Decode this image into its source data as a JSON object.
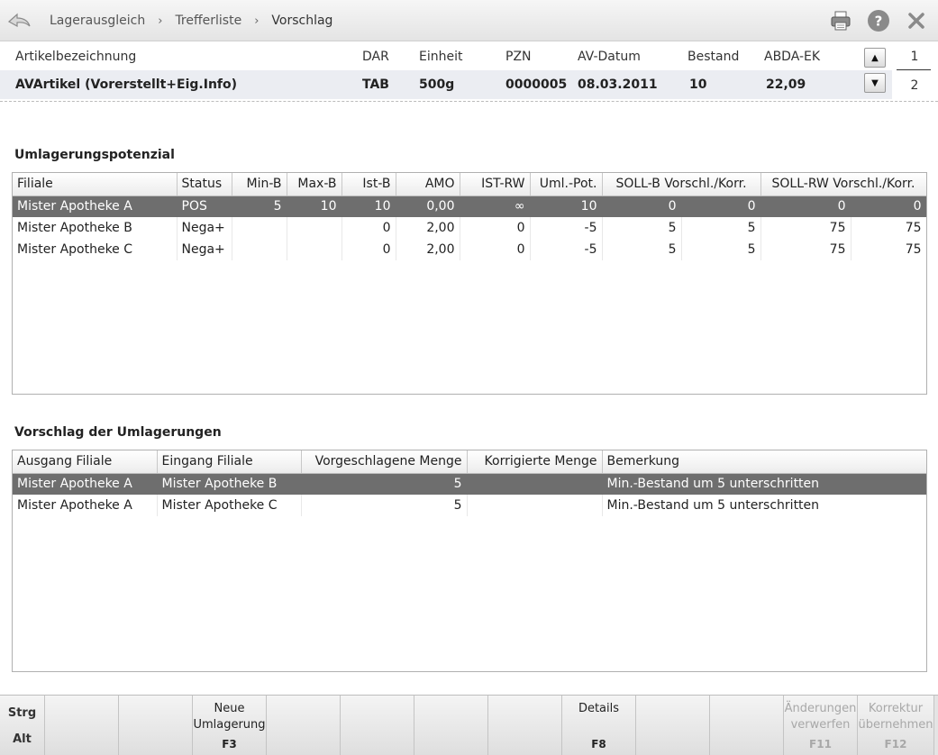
{
  "breadcrumb": [
    "Lagerausgleich",
    "Trefferliste",
    "Vorschlag"
  ],
  "header_icons": [
    "printer-icon",
    "help-icon",
    "close-icon"
  ],
  "article": {
    "headers": {
      "name": "Artikelbezeichnung",
      "dar": "DAR",
      "einheit": "Einheit",
      "pzn": "PZN",
      "av_datum": "AV-Datum",
      "bestand": "Bestand",
      "abda_ek": "ABDA-EK"
    },
    "row": {
      "name": "AVArtikel (Vorerstellt+Eig.Info)",
      "dar": "TAB",
      "einheit": "500g",
      "pzn": "0000005",
      "av_datum": "08.03.2011",
      "bestand": "10",
      "abda_ek": "22,09"
    },
    "page_current": "1",
    "page_total": "2"
  },
  "potenzial": {
    "title": "Umlagerungspotenzial",
    "columns": [
      "Filiale",
      "Status",
      "Min-B",
      "Max-B",
      "Ist-B",
      "AMO",
      "IST-RW",
      "Uml.-Pot.",
      "SOLL-B Vorschl./Korr.",
      "SOLL-RW Vorschl./Korr."
    ],
    "rows": [
      {
        "filiale": "Mister Apotheke A",
        "status": "POS",
        "minb": "5",
        "maxb": "10",
        "istb": "10",
        "amo": "0,00",
        "istrw": "∞",
        "umlpot": "10",
        "sollb_v": "0",
        "sollb_k": "0",
        "sollrw_v": "0",
        "sollrw_k": "0",
        "selected": true
      },
      {
        "filiale": "Mister Apotheke B",
        "status": "Nega+",
        "minb": "",
        "maxb": "",
        "istb": "0",
        "amo": "2,00",
        "istrw": "0",
        "umlpot": "-5",
        "sollb_v": "5",
        "sollb_k": "5",
        "sollrw_v": "75",
        "sollrw_k": "75",
        "selected": false
      },
      {
        "filiale": "Mister Apotheke C",
        "status": "Nega+",
        "minb": "",
        "maxb": "",
        "istb": "0",
        "amo": "2,00",
        "istrw": "0",
        "umlpot": "-5",
        "sollb_v": "5",
        "sollb_k": "5",
        "sollrw_v": "75",
        "sollrw_k": "75",
        "selected": false
      }
    ]
  },
  "vorschlag": {
    "title": "Vorschlag der Umlagerungen",
    "columns": [
      "Ausgang Filiale",
      "Eingang Filiale",
      "Vorgeschlagene Menge",
      "Korrigierte Menge",
      "Bemerkung"
    ],
    "rows": [
      {
        "ausgang": "Mister Apotheke A",
        "eingang": "Mister Apotheke B",
        "vorgeschlagen": "5",
        "korrigiert": "",
        "bemerkung": "Min.-Bestand um 5 unterschritten",
        "selected": true
      },
      {
        "ausgang": "Mister Apotheke A",
        "eingang": "Mister Apotheke C",
        "vorgeschlagen": "5",
        "korrigiert": "",
        "bemerkung": "Min.-Bestand um 5 unterschritten",
        "selected": false
      }
    ]
  },
  "footer": {
    "mod_top": "Strg",
    "mod_bottom": "Alt",
    "keys": [
      {
        "label": "",
        "key": "",
        "disabled": false
      },
      {
        "label": "",
        "key": "",
        "disabled": false
      },
      {
        "label": "Neue\nUmlagerung",
        "key": "F3",
        "disabled": false
      },
      {
        "label": "",
        "key": "",
        "disabled": false
      },
      {
        "label": "",
        "key": "",
        "disabled": false
      },
      {
        "label": "",
        "key": "",
        "disabled": false
      },
      {
        "label": "",
        "key": "",
        "disabled": false
      },
      {
        "label": "Details",
        "key": "F8",
        "disabled": false
      },
      {
        "label": "",
        "key": "",
        "disabled": false
      },
      {
        "label": "",
        "key": "",
        "disabled": false
      },
      {
        "label": "Änderungen\nverwerfen",
        "key": "F11",
        "disabled": true
      },
      {
        "label": "Korrektur\nübernehmen",
        "key": "F12",
        "disabled": true
      }
    ]
  }
}
